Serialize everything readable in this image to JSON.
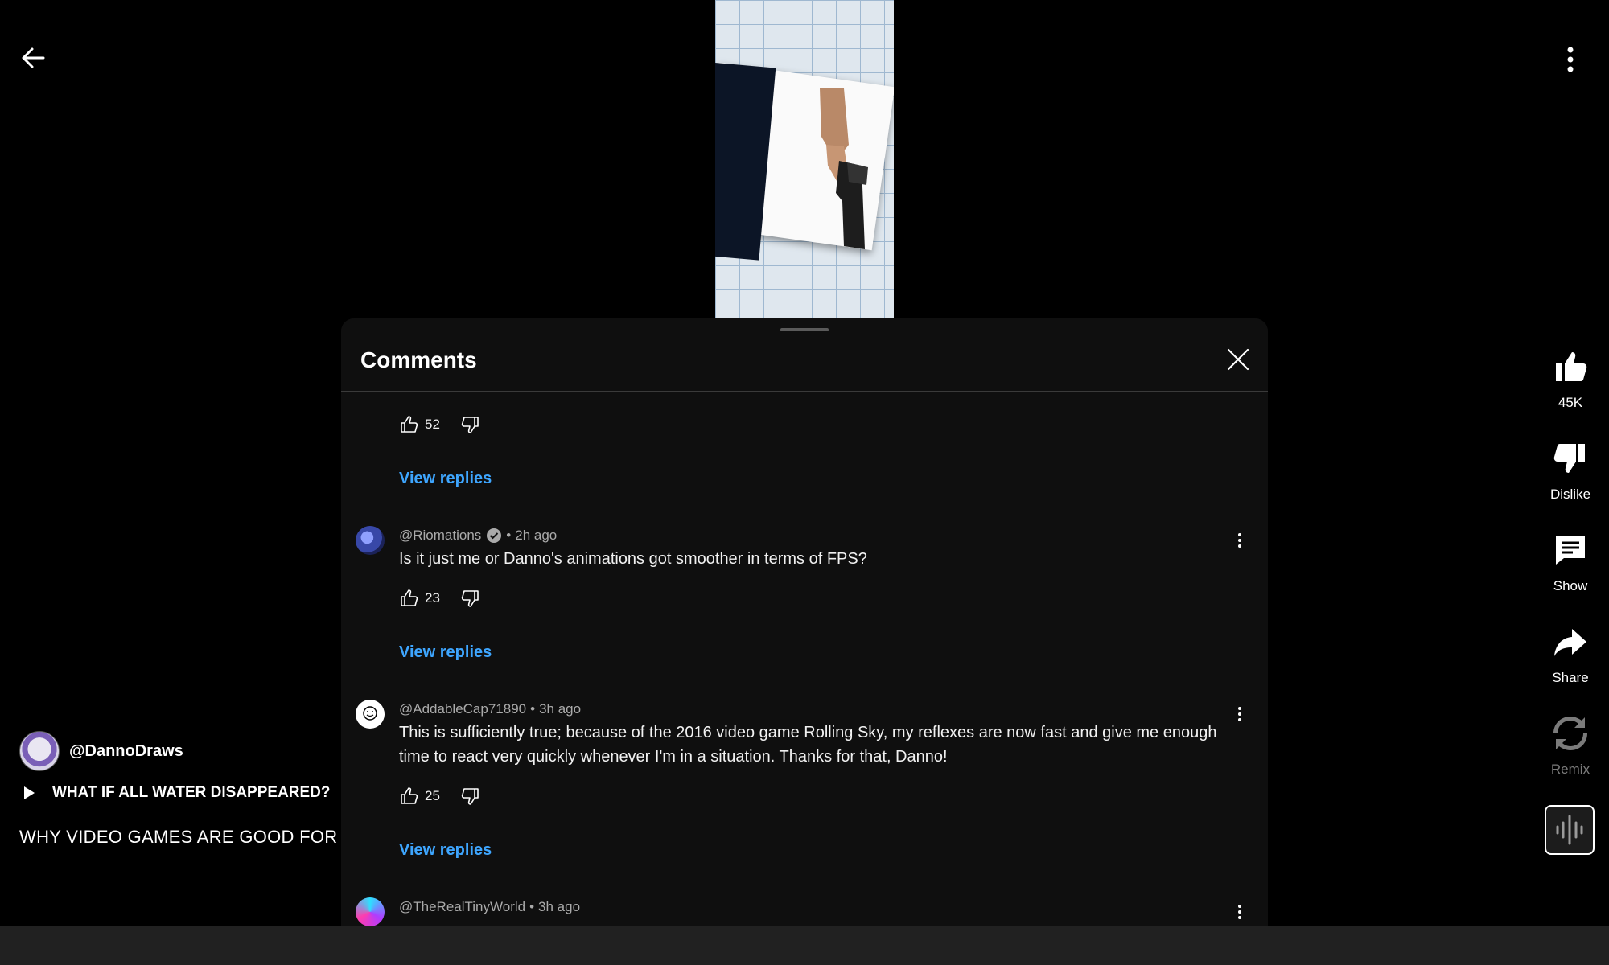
{
  "video": {
    "description": "Shorts video frame: hand holding a pistol over a graph-paper background"
  },
  "channel": {
    "handle": "@DannoDraws"
  },
  "playlist": {
    "label": "WHAT IF ALL WATER DISAPPEARED?"
  },
  "video_title": "WHY VIDEO GAMES ARE GOOD FOR Y",
  "rail": {
    "like_count": "45K",
    "dislike_label": "Dislike",
    "comments_label": "Show",
    "share_label": "Share",
    "remix_label": "Remix"
  },
  "comments_panel": {
    "title": "Comments",
    "partial_text": "...",
    "first_likes": "52",
    "view_replies": "View replies",
    "comments": [
      {
        "author": "@Riomations",
        "verified": true,
        "time": "2h ago",
        "text": "Is it just me or Danno's animations got smoother in terms of FPS?",
        "likes": "23"
      },
      {
        "author": "@AddableCap71890",
        "verified": false,
        "time": "3h ago",
        "text": "This is sufficiently true; because of the 2016 video game Rolling Sky, my reflexes are now fast and give me enough time to react very quickly whenever I'm in a situation. Thanks for that, Danno!",
        "likes": "25"
      },
      {
        "author": "@TheRealTinyWorld",
        "verified": false,
        "time": "3h ago",
        "text": "",
        "likes": ""
      }
    ]
  },
  "colors": {
    "accent_link": "#3ea6ff",
    "panel_bg": "#0f0f0f"
  }
}
